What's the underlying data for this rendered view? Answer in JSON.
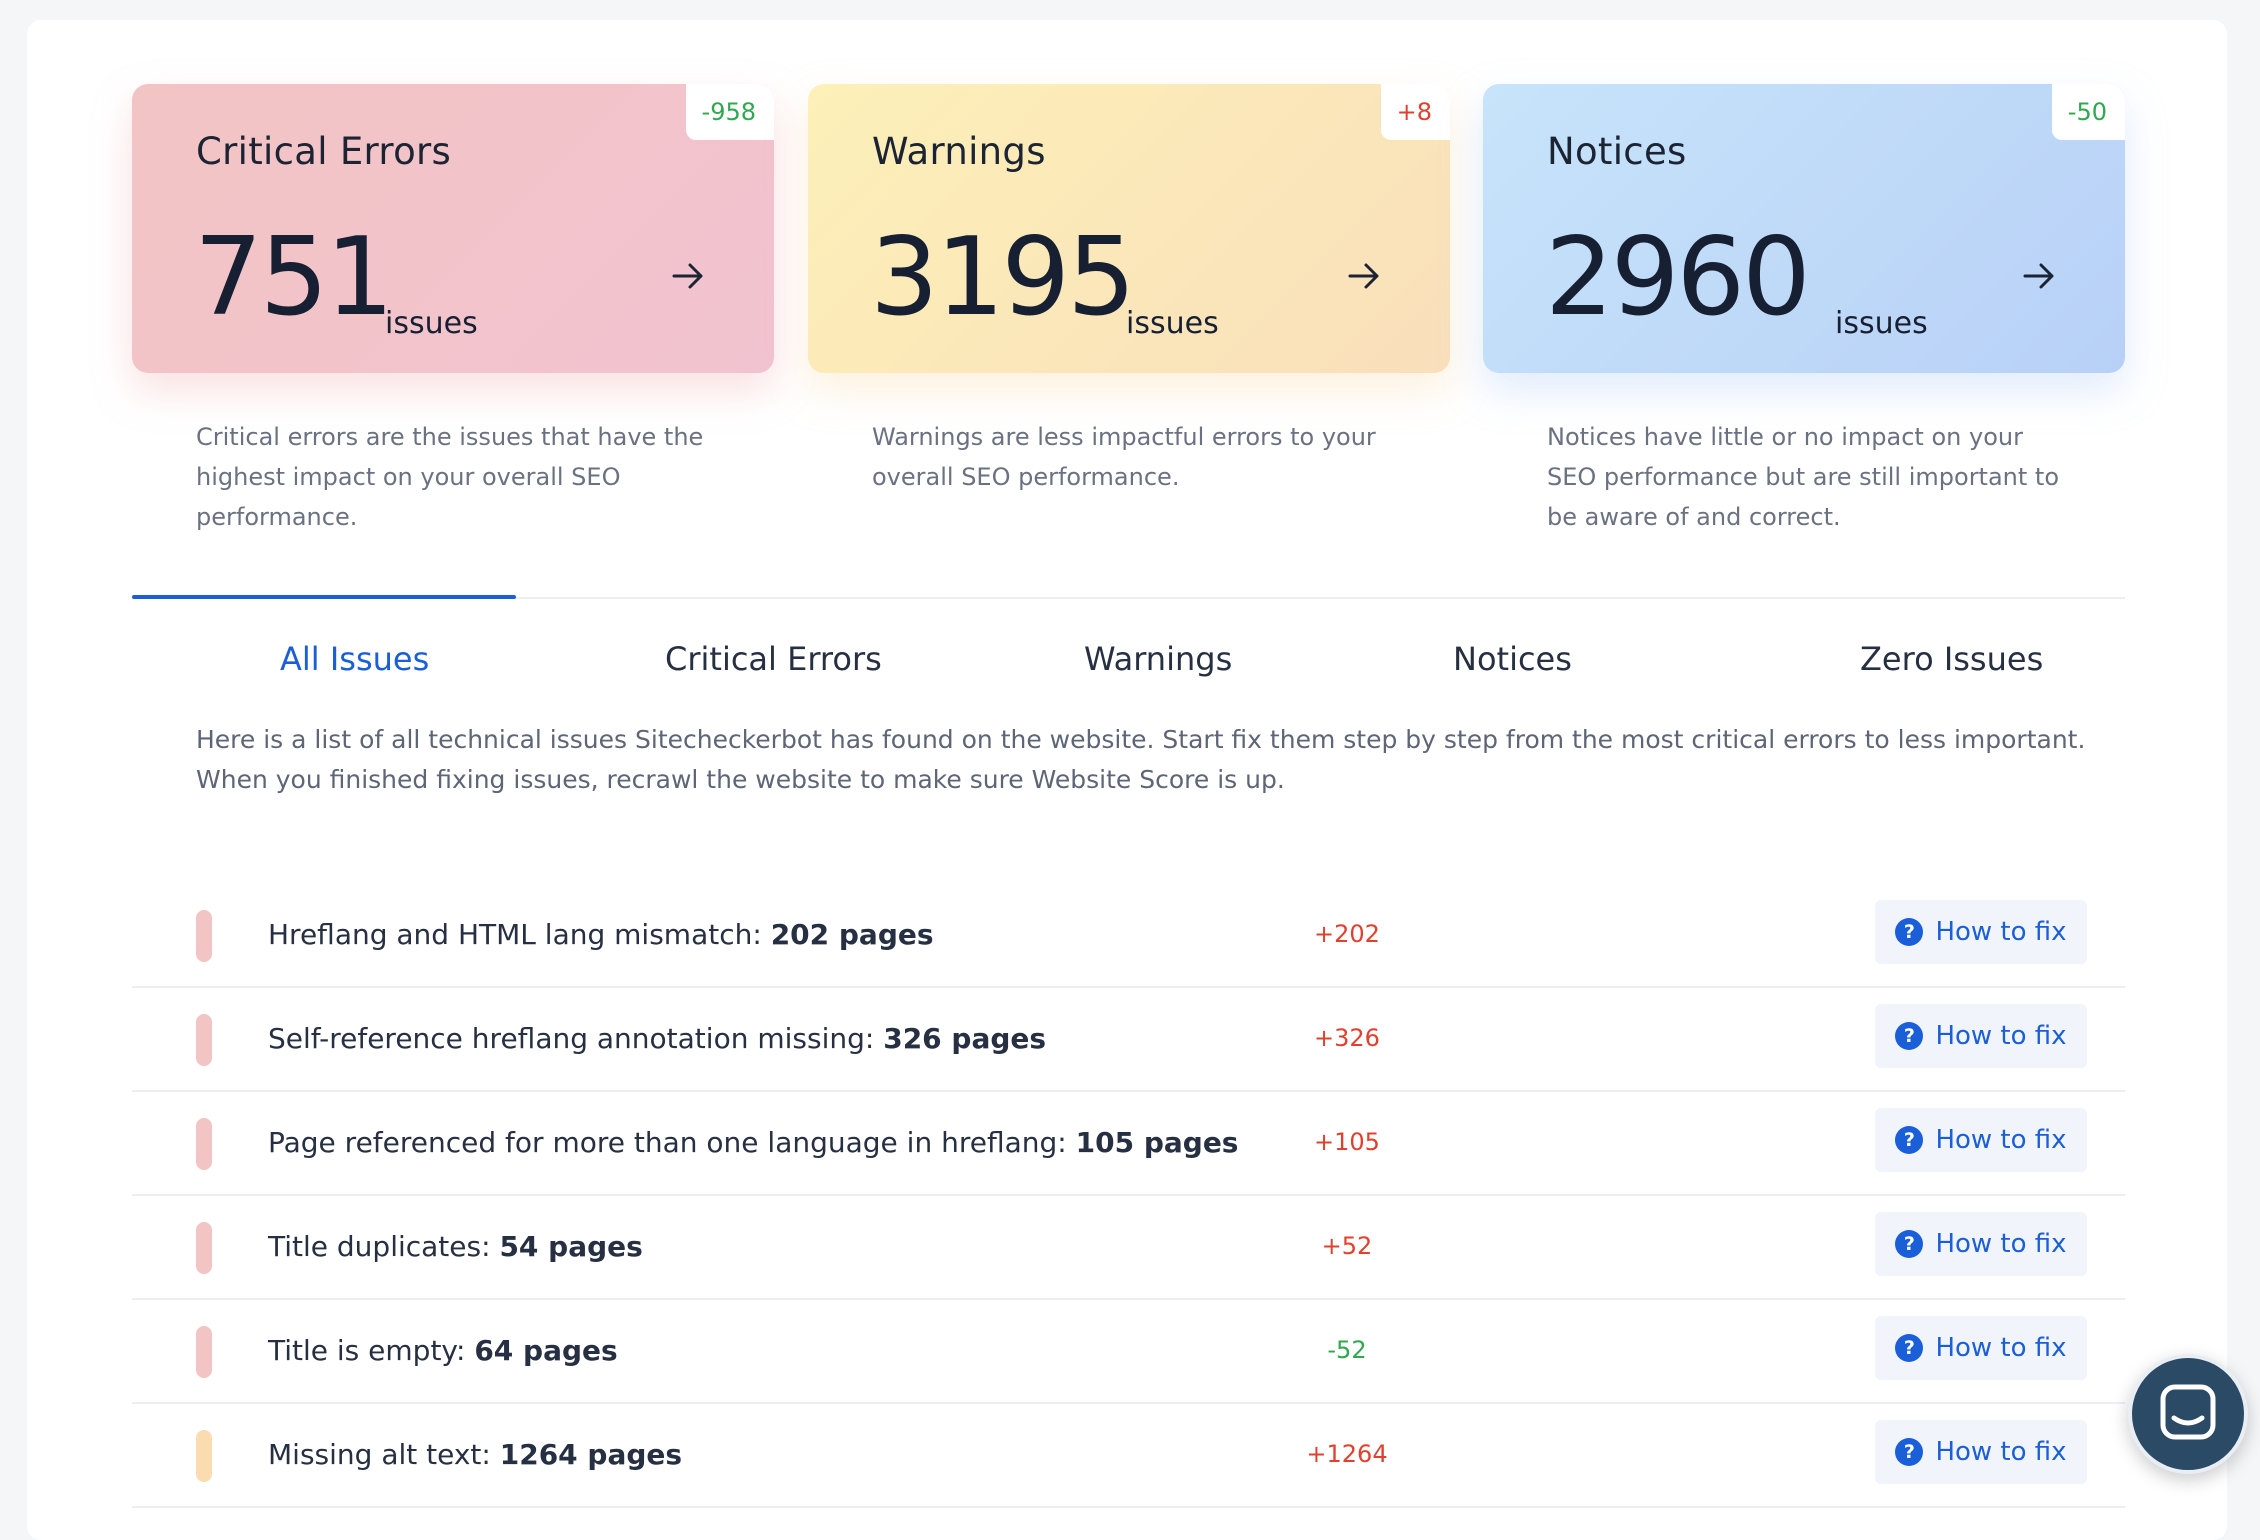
{
  "cards": [
    {
      "title": "Critical Errors",
      "number": "751",
      "unit": "issues",
      "delta": "-958",
      "desc": "Critical errors are the issues that have the highest impact on your overall SEO performance."
    },
    {
      "title": "Warnings",
      "number": "3195",
      "unit": "issues",
      "delta": "+8",
      "desc": "Warnings are less impactful errors to your overall SEO performance."
    },
    {
      "title": "Notices",
      "number": "2960",
      "unit": "issues",
      "delta": "-50",
      "desc": "Notices have little or no impact on your SEO performance but are still important to be aware of and correct."
    }
  ],
  "tabs": [
    "All Issues",
    "Critical Errors",
    "Warnings",
    "Notices",
    "Zero Issues"
  ],
  "intro": "Here is a list of all technical issues Sitecheckerbot has found on the website. Start fix them step by step from the most critical errors to less important. When you finished fixing issues, recrawl the website to make sure Website Score is up.",
  "fix_label": "How to fix",
  "issues": [
    {
      "label": "Hreflang and HTML lang mismatch:",
      "count": "202 pages",
      "delta": "+202",
      "level": "critical"
    },
    {
      "label": "Self-reference hreflang annotation missing:",
      "count": "326 pages",
      "delta": "+326",
      "level": "critical"
    },
    {
      "label": "Page referenced for more than one language in hreflang:",
      "count": "105 pages",
      "delta": "+105",
      "level": "critical"
    },
    {
      "label": "Title duplicates:",
      "count": "54 pages",
      "delta": "+52",
      "level": "critical"
    },
    {
      "label": "Title is empty:",
      "count": "64 pages",
      "delta": "-52",
      "level": "critical"
    },
    {
      "label": "Missing alt text:",
      "count": "1264 pages",
      "delta": "+1264",
      "level": "warning"
    }
  ],
  "colors": {
    "accent": "#1a5fd8",
    "positive_delta": "#e0402e",
    "negative_delta": "#2fa84f"
  },
  "icons": {
    "card_arrow": "arrow-right-icon",
    "fix": "question-circle-icon",
    "chat": "chat-icon"
  }
}
